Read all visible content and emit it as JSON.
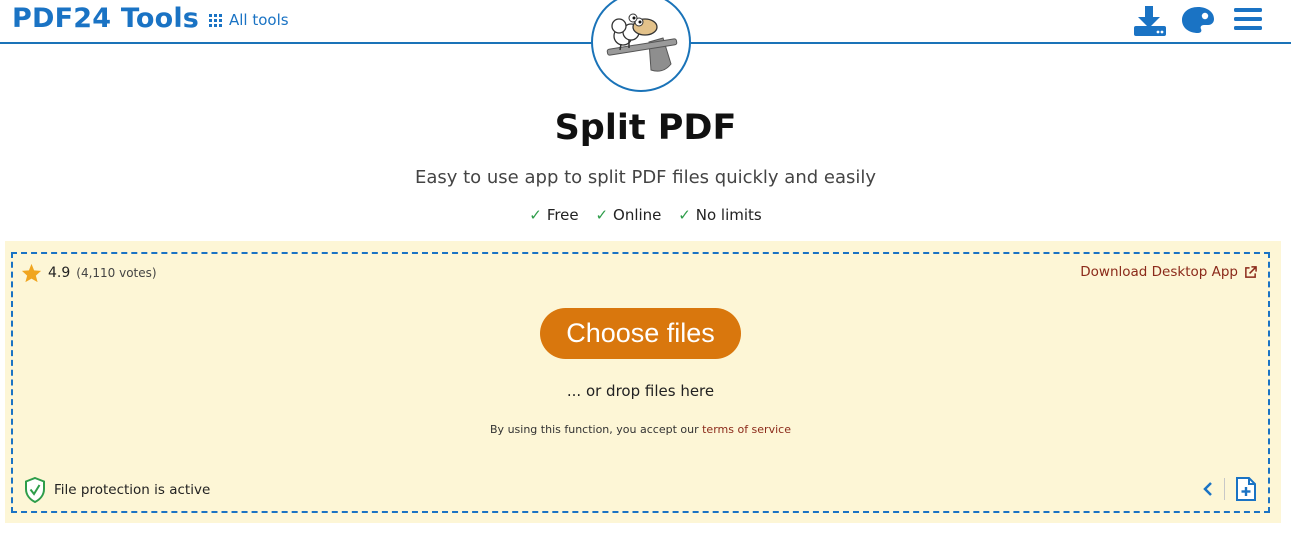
{
  "header": {
    "brand": "PDF24 Tools",
    "all_tools_label": "All tools",
    "icons": [
      "download-icon",
      "palette-icon",
      "hamburger-menu-icon"
    ]
  },
  "page": {
    "title": "Split PDF",
    "subtitle": "Easy to use app to split PDF files quickly and easily",
    "features": [
      "Free",
      "Online",
      "No limits"
    ],
    "check_mark": "✓"
  },
  "upload": {
    "rating": "4.9",
    "votes": "(4,110 votes)",
    "desktop_app_label": "Download Desktop App",
    "choose_files_label": "Choose files",
    "drop_text": "... or drop files here",
    "terms_prefix": "By using this function, you accept our",
    "terms_link": "terms of service",
    "protection_text": "File protection is active"
  },
  "colors": {
    "brand_blue": "#1a73c4",
    "button_orange": "#d9770d",
    "drop_bg": "#fdf6d6",
    "link_red": "#8b2a1a",
    "check_green": "#2e9d4a"
  }
}
